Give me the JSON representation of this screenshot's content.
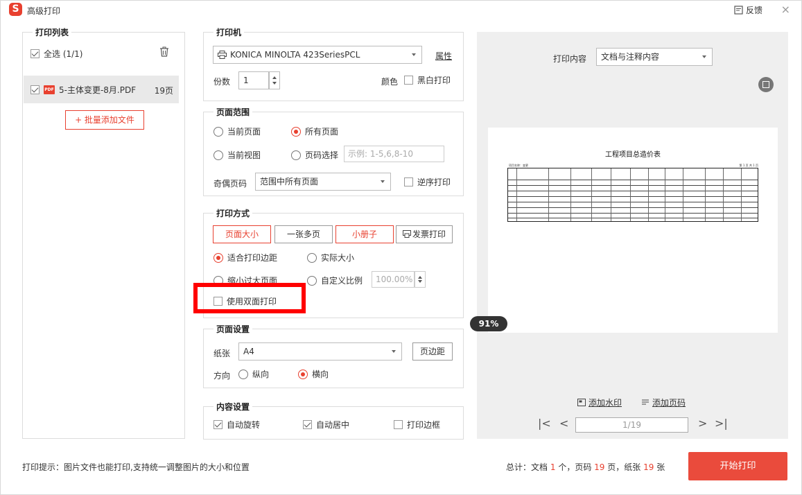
{
  "app": {
    "title": "高级打印",
    "logo_letter": "S",
    "feedback_label": "反馈",
    "close_label": "×"
  },
  "file_list": {
    "legend": "打印列表",
    "select_all_label": "全选 (1/1)",
    "select_all_checked": true,
    "files": [
      {
        "name": "5-主体变更-8月.PDF",
        "pages": "19页",
        "checked": true,
        "icon_text": "PDF"
      }
    ],
    "add_button_label": "+ 批量添加文件"
  },
  "printer": {
    "legend": "打印机",
    "name": "KONICA MINOLTA 423SeriesPCL",
    "properties_link": "属性",
    "copies_label": "份数",
    "copies_value": "1",
    "color_label": "颜色",
    "bw_label": "黑白打印",
    "bw_checked": false
  },
  "page_range": {
    "legend": "页面范围",
    "current_page_label": "当前页面",
    "all_pages_label": "所有页面",
    "current_view_label": "当前视图",
    "page_select_label": "页码选择",
    "page_select_placeholder": "示例: 1-5,6,8-10",
    "selected": "all_pages",
    "odd_even_label": "奇偶页码",
    "odd_even_value": "范围中所有页面",
    "reverse_label": "逆序打印",
    "reverse_checked": false
  },
  "print_method": {
    "legend": "打印方式",
    "modes": [
      "页面大小",
      "一张多页",
      "小册子",
      "发票打印"
    ],
    "active_mode": "页面大小",
    "fit_margin_label": "适合打印边距",
    "actual_size_label": "实际大小",
    "shrink_label": "缩小过大页面",
    "custom_scale_label": "自定义比例",
    "custom_scale_value": "100.00%",
    "selected": "fit_margin",
    "duplex_label": "使用双面打印",
    "duplex_checked": false
  },
  "page_setup": {
    "legend": "页面设置",
    "paper_label": "纸张",
    "paper_value": "A4",
    "margin_button": "页边距",
    "orientation_label": "方向",
    "portrait_label": "纵向",
    "landscape_label": "横向",
    "orientation": "landscape"
  },
  "content_setup": {
    "legend": "内容设置",
    "auto_rotate_label": "自动旋转",
    "auto_rotate_checked": true,
    "auto_center_label": "自动居中",
    "auto_center_checked": true,
    "print_border_label": "打印边框",
    "print_border_checked": false
  },
  "preview": {
    "content_label": "打印内容",
    "content_value": "文档与注释内容",
    "zoom": "91%",
    "sheet_title": "工程项目总造价表",
    "sheet_left_caption": "项目名称：变更",
    "sheet_right_caption": "第 1 页 共 1 页",
    "add_watermark": "添加水印",
    "add_page_number": "添加页码",
    "page_indicator": "1/19"
  },
  "footer": {
    "hint": "打印提示：图片文件也能打印,支持统一调整图片的大小和位置",
    "summary_prefix": "总计：文档",
    "doc_count": "1",
    "summary_mid1": "个，页码",
    "page_count": "19",
    "summary_mid2": "页，纸张",
    "sheet_count": "19",
    "summary_suffix": "张",
    "start_button": "开始打印"
  },
  "colors": {
    "accent": "#e8402f",
    "start_button": "#ea4b3c",
    "highlight": "#ff0000"
  }
}
